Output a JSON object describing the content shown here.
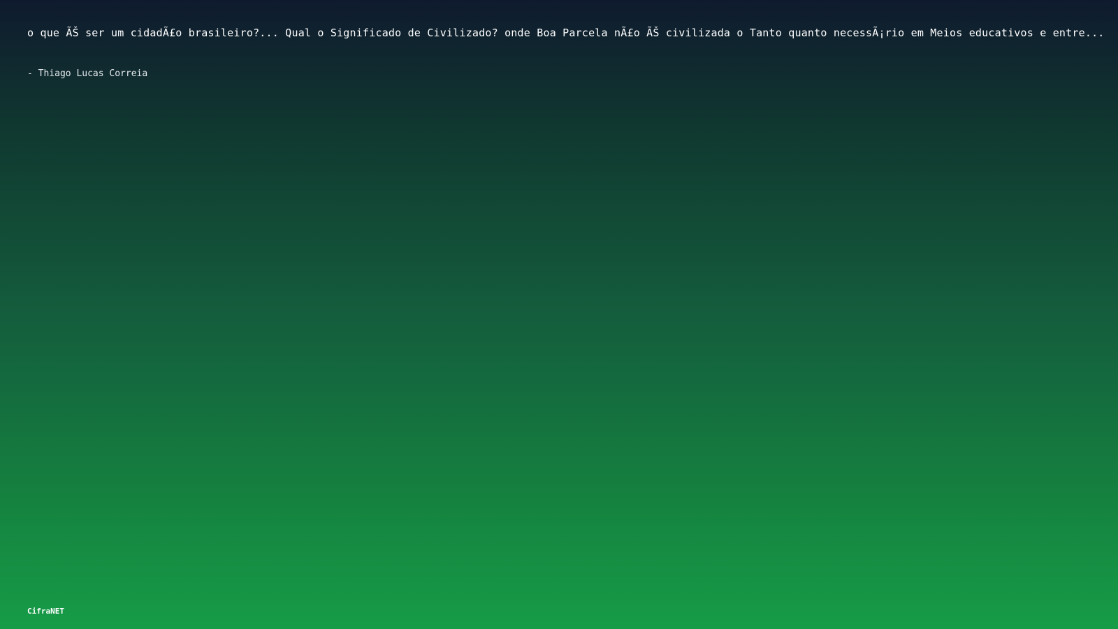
{
  "quote": {
    "text": "o que ÃŠ ser um cidadÃ£o brasileiro?... Qual o Significado de Civilizado? onde Boa Parcela nÃ£o ÃŠ civilizada o Tanto quanto necessÃ¡rio em Meios educativos e entre...",
    "author": "- Thiago Lucas Correia"
  },
  "brand": {
    "name": "CifraNET"
  },
  "colors": {
    "background_top": "#0f1a2e",
    "background_bottom": "#169c47",
    "text": "#ffffff"
  }
}
